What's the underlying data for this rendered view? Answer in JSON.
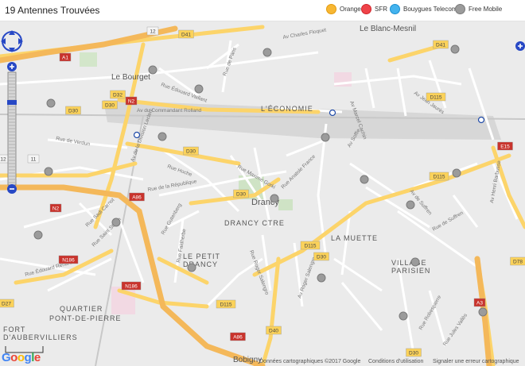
{
  "header": {
    "title": "19 Antennes Trouvées"
  },
  "legend": [
    {
      "label": "Orange",
      "color": "#f7b733",
      "ring": "#e49b0f"
    },
    {
      "label": "SFR",
      "color": "#ef4349",
      "ring": "#d0252b"
    },
    {
      "label": "Bouygues Telecom",
      "color": "#43b3ee",
      "ring": "#1b8fd0"
    },
    {
      "label": "Free Mobile",
      "color": "#9b9b9b",
      "ring": "#7a7a7a"
    }
  ],
  "map": {
    "place_labels": [
      "Le Blanc-Mesnil",
      "Le Bourget",
      "L'ÉCONOMIE",
      "Drancy",
      "DRANCY CTRE",
      "LA MUETTE",
      "VILLAGE",
      "PARISIEN",
      "LE PETIT",
      "DRANCY",
      "QUARTIER",
      "PONT-DE-PIERRE",
      "FORT",
      "D'AUBERVILLIERS",
      "Bobigny"
    ],
    "street_labels": [
      "Av Charles Floquet",
      "Rue Édouard Vaillant",
      "Av du Commandant Rolland",
      "Rue de Paris",
      "Av de la Division Leclerc",
      "Rue Hoche",
      "Rue de la République",
      "Rue Anatole France",
      "Rue Maxime Gorki",
      "Rue Gutenberg",
      "Rue Faidherbe",
      "Rue Sadi Carnot",
      "Rue Saint Stenin",
      "Rue Édouard Renard",
      "Rue Roger Salengro",
      "Av Roger Salengro",
      "Av Jean Jaurès",
      "Av de Suffren",
      "Rue de Suffren",
      "Av Soffie",
      "Rue Robespierre",
      "Rue Jules Vallès",
      "Av Marcel Cachin",
      "Rue de Verdun",
      "Av Henri Barbusse"
    ],
    "road_badges": [
      "D41",
      "D41",
      "A1",
      "D32",
      "N2",
      "D30",
      "D30",
      "D30",
      "D30",
      "D30",
      "N2",
      "A86",
      "A86",
      "D115",
      "D115",
      "D115",
      "D115",
      "N186",
      "N186",
      "D40",
      "D30",
      "D27",
      "D78",
      "E15",
      "A3",
      "12",
      "11",
      "12"
    ],
    "antennas": {
      "operator": "Free Mobile",
      "count": 19
    },
    "footer": {
      "attribution": "Données cartographiques ©2017 Google",
      "terms": "Conditions d'utilisation",
      "report": "Signaler une erreur cartographique",
      "logo": "Google"
    }
  }
}
